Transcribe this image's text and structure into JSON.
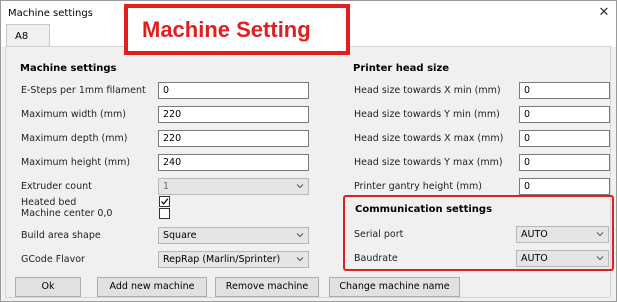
{
  "window": {
    "title": "Machine settings",
    "tab": "A8",
    "annotation": "Machine Setting"
  },
  "machine": {
    "heading": "Machine settings",
    "e_steps": {
      "label": "E-Steps per 1mm filament",
      "value": "0"
    },
    "max_width": {
      "label": "Maximum width (mm)",
      "value": "220"
    },
    "max_depth": {
      "label": "Maximum depth (mm)",
      "value": "220"
    },
    "max_height": {
      "label": "Maximum height (mm)",
      "value": "240"
    },
    "extruder_count": {
      "label": "Extruder count",
      "value": "1"
    },
    "heated_bed": {
      "label": "Heated bed",
      "checked": true
    },
    "machine_center": {
      "label": "Machine center 0,0",
      "checked": false
    },
    "build_area_shape": {
      "label": "Build area shape",
      "value": "Square"
    },
    "gcode_flavor": {
      "label": "GCode Flavor",
      "value": "RepRap (Marlin/Sprinter)"
    }
  },
  "printer_head": {
    "heading": "Printer head size",
    "x_min": {
      "label": "Head size towards X min (mm)",
      "value": "0"
    },
    "y_min": {
      "label": "Head size towards Y min (mm)",
      "value": "0"
    },
    "x_max": {
      "label": "Head size towards X max (mm)",
      "value": "0"
    },
    "y_max": {
      "label": "Head size towards Y max (mm)",
      "value": "0"
    },
    "gantry_height": {
      "label": "Printer gantry height (mm)",
      "value": "0"
    }
  },
  "communication": {
    "heading": "Communication settings",
    "serial_port": {
      "label": "Serial port",
      "value": "AUTO"
    },
    "baudrate": {
      "label": "Baudrate",
      "value": "AUTO"
    }
  },
  "buttons": {
    "ok": "Ok",
    "add_machine": "Add new machine",
    "remove_machine": "Remove machine",
    "change_name": "Change machine name"
  },
  "colors": {
    "annotation_red": "#e02020",
    "window_bg": "#f0f0f0"
  },
  "icons": {
    "close": "close-icon",
    "dropdown": "chevron-down-icon",
    "checkmark": "checkmark-icon"
  }
}
